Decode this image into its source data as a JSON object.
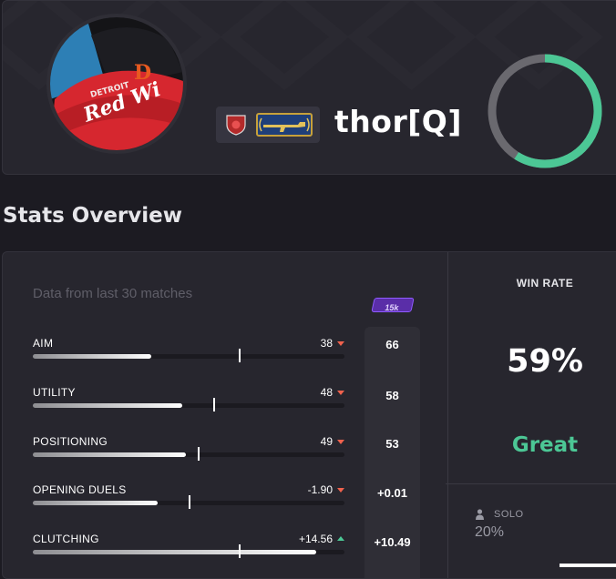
{
  "profile": {
    "username": "thor[Q]",
    "avatar_icon": "avatar-photo-icon",
    "rank_badge_icon": "rank-shield-icon",
    "medal_badge_icon": "rifle-medal-icon"
  },
  "stats_overview": {
    "title": "Stats Overview",
    "data_note": "Data from last 30 matches",
    "rating_tag": "15k",
    "rows": [
      {
        "label": "AIM",
        "value": "38",
        "trend": "down",
        "avg": "66",
        "fill": 0.38,
        "marker": 0.66
      },
      {
        "label": "UTILITY",
        "value": "48",
        "trend": "down",
        "avg": "58",
        "fill": 0.48,
        "marker": 0.58
      },
      {
        "label": "POSITIONING",
        "value": "49",
        "trend": "down",
        "avg": "53",
        "fill": 0.49,
        "marker": 0.53
      },
      {
        "label": "OPENING DUELS",
        "value": "-1.90",
        "trend": "down",
        "avg": "+0.01",
        "fill": 0.4,
        "marker": 0.5
      },
      {
        "label": "CLUTCHING",
        "value": "+14.56",
        "trend": "up",
        "avg": "+10.49",
        "fill": 0.91,
        "marker": 0.66
      }
    ]
  },
  "win_rate": {
    "title": "WIN RATE",
    "percent": "59%",
    "fraction": 0.59,
    "verdict": "Great",
    "solo_label": "SOLO",
    "solo_value": "20%"
  },
  "colors": {
    "accent_green": "#4cc795",
    "trend_down": "#f0624d",
    "ring_track": "#6a696f",
    "rating_purple": "#5a2ea8"
  }
}
